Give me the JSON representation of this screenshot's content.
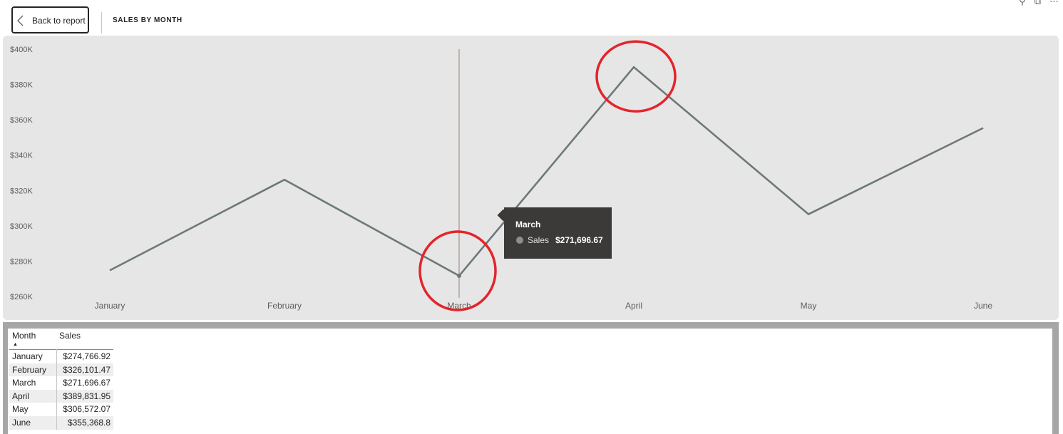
{
  "header": {
    "back_label": "Back to report",
    "title": "SALES BY MONTH"
  },
  "colors": {
    "line": "#6d7878",
    "panel_bg": "#e6e6e6",
    "annotation_circle": "#e3242b",
    "tooltip_bg": "#3b3a39"
  },
  "chart_data": {
    "type": "line",
    "categories": [
      "January",
      "February",
      "March",
      "April",
      "May",
      "June"
    ],
    "series": [
      {
        "values": [
          274766.92,
          326101.47,
          271696.67,
          389831.95,
          306572.07,
          355368.8
        ]
      }
    ],
    "ylim": [
      260000,
      400000
    ],
    "yticks": [
      260000,
      280000,
      300000,
      320000,
      340000,
      360000,
      380000,
      400000
    ],
    "ytick_labels": [
      "$260K",
      "$280K",
      "$300K",
      "$320K",
      "$340K",
      "$360K",
      "$380K",
      "$400K"
    ],
    "grid": false,
    "highlight_category": "March",
    "annotations": [
      "circle around March",
      "circle around April"
    ]
  },
  "tooltip": {
    "title": "March",
    "series_name": "Sales",
    "value": "$271,696.67"
  },
  "table": {
    "headers": [
      "Month",
      "Sales"
    ],
    "rows": [
      [
        "January",
        "$274,766.92"
      ],
      [
        "February",
        "$326,101.47"
      ],
      [
        "March",
        "$271,696.67"
      ],
      [
        "April",
        "$389,831.95"
      ],
      [
        "May",
        "$306,572.07"
      ],
      [
        "June",
        "$355,368.8"
      ]
    ]
  }
}
